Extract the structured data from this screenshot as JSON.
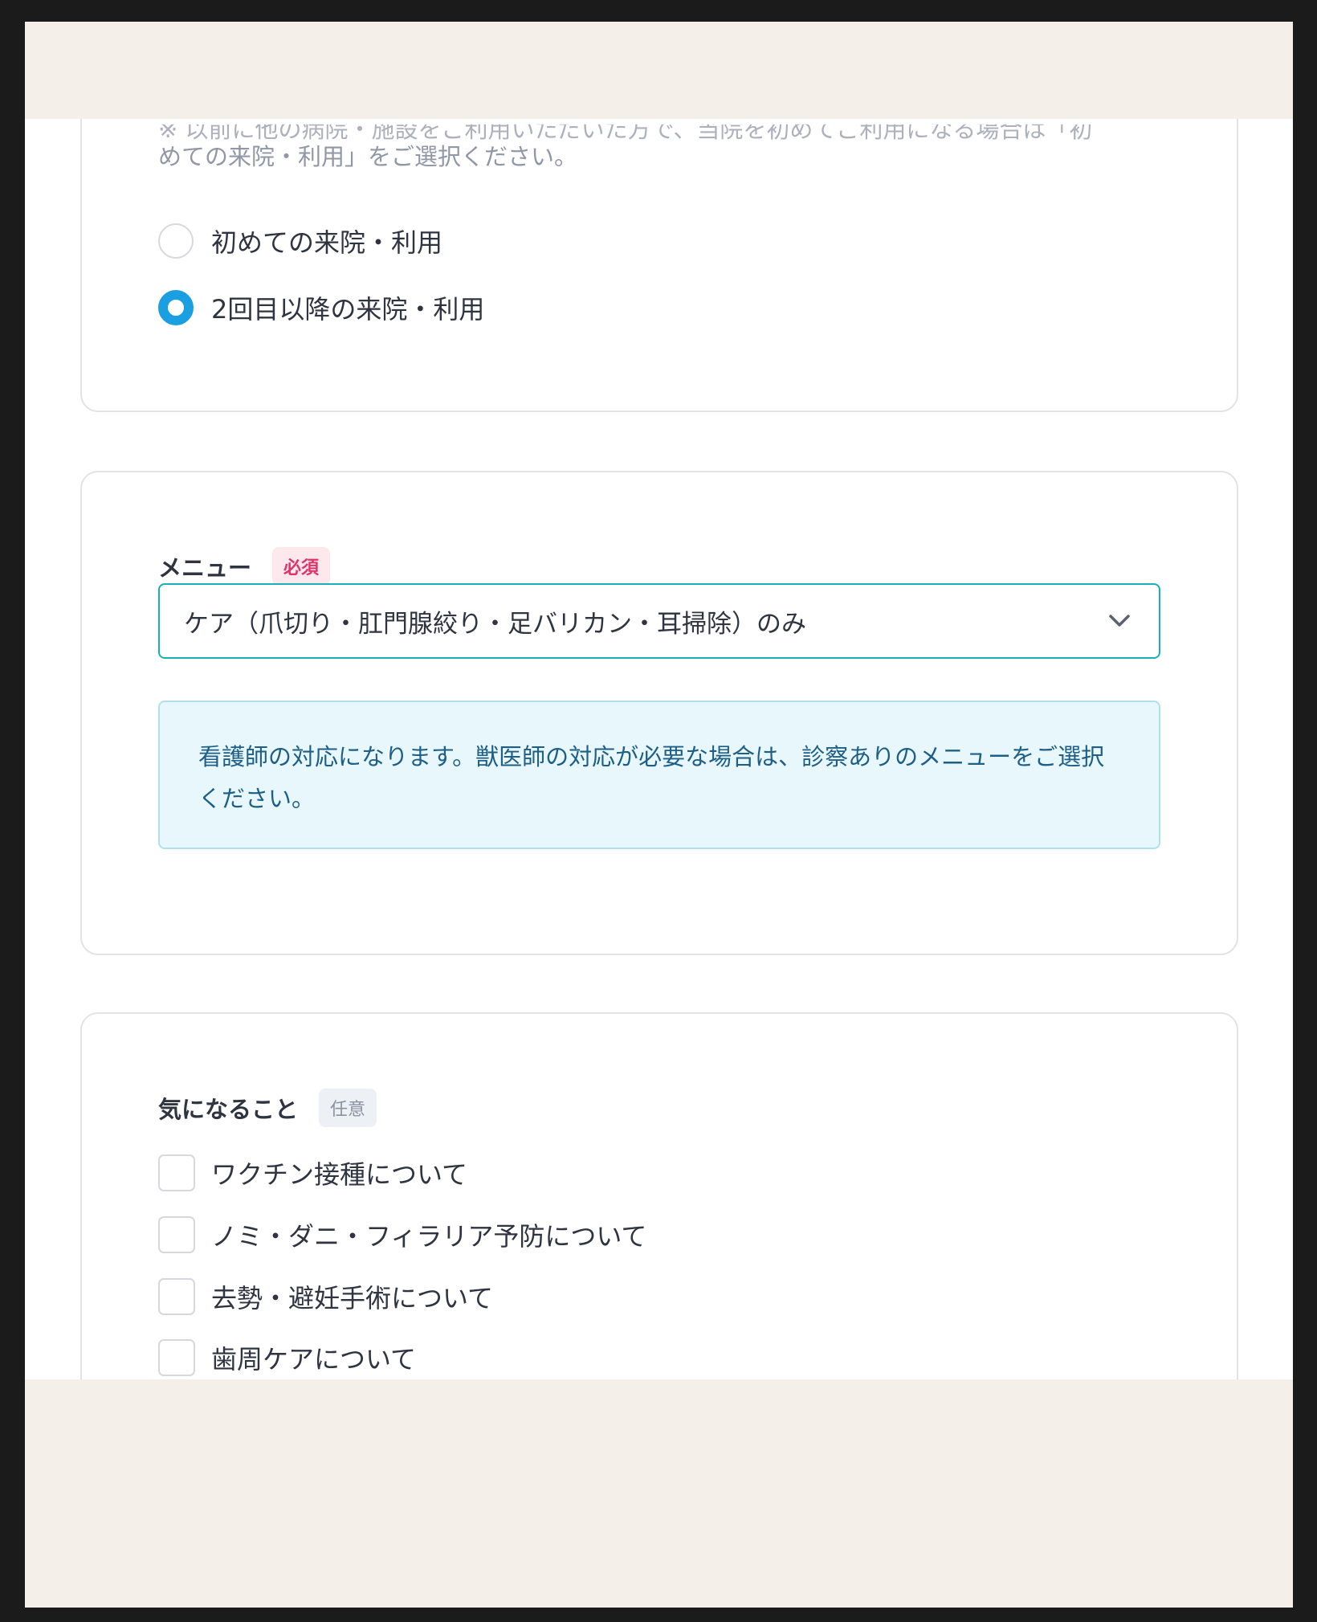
{
  "visit": {
    "description_partial": "※ 以前に他の病院・施設をご利用いただいた方で、当院を初めてご利用になる場合は「初",
    "description": "めての来院・利用」をご選択ください。",
    "options": [
      {
        "label": "初めての来院・利用",
        "selected": false
      },
      {
        "label": "2回目以降の来院・利用",
        "selected": true
      }
    ]
  },
  "menu": {
    "title": "メニュー",
    "required_badge": "必須",
    "selected_value": "ケア（爪切り・肛門腺絞り・足バリカン・耳掃除）のみ",
    "notice": "看護師の対応になります。獣医師の対応が必要な場合は、診察ありのメニューをご選択ください。"
  },
  "concerns": {
    "title": "気になること",
    "optional_badge": "任意",
    "options": [
      {
        "label": "ワクチン接種について",
        "checked": false
      },
      {
        "label": "ノミ・ダニ・フィラリア予防について",
        "checked": false
      },
      {
        "label": "去勢・避妊手術について",
        "checked": false
      },
      {
        "label": "歯周ケアについて",
        "checked": false
      }
    ]
  },
  "colors": {
    "accent": "#1aa0e0",
    "required": "#e0336a",
    "notice_bg": "#e8f7fc",
    "page_bg": "#f5efe9"
  }
}
